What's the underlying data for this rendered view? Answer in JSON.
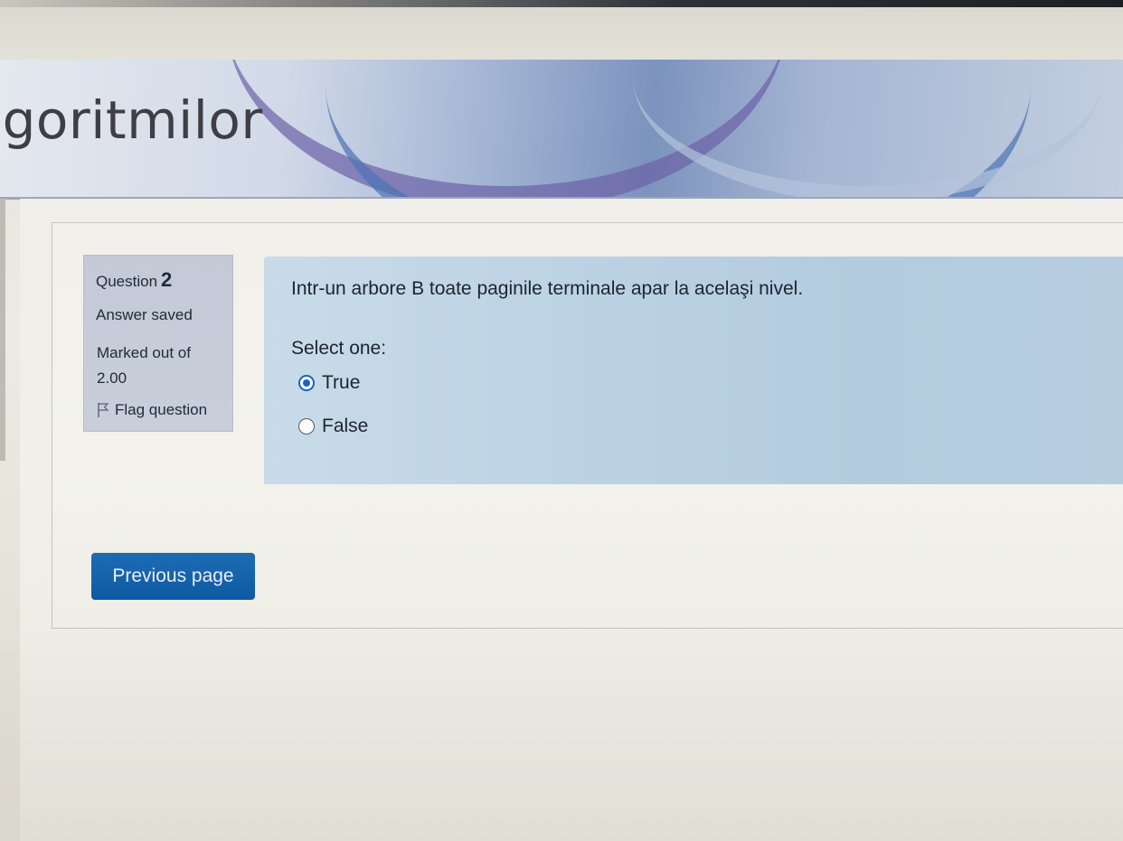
{
  "header": {
    "course_title": "lgoritmilor"
  },
  "question_info": {
    "question_label": "Question",
    "question_number": "2",
    "state": "Answer saved",
    "grade_label": "Marked out of",
    "grade_value": "2.00",
    "flag_label": "Flag question"
  },
  "question": {
    "text": "Intr-un arbore B toate paginile terminale apar la acelaşi nivel.",
    "prompt": "Select one:",
    "options": [
      {
        "label": "True",
        "selected": true
      },
      {
        "label": "False",
        "selected": false
      }
    ]
  },
  "navigation": {
    "previous_label": "Previous page"
  },
  "colors": {
    "accent": "#1a62c8",
    "button": "#0e5aa2",
    "question_bg": "#bcd3e4",
    "info_bg": "#c6ccd8"
  }
}
